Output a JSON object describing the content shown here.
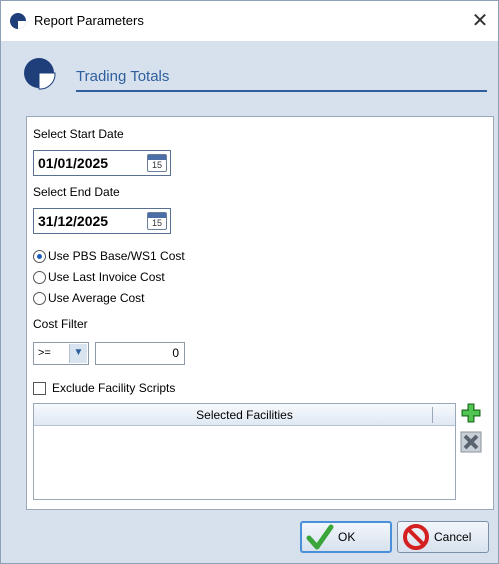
{
  "window": {
    "title": "Report Parameters",
    "close_glyph": "✕"
  },
  "header": {
    "title": "Trading Totals"
  },
  "dates": {
    "start_label": "Select Start Date",
    "start_value": "01/01/2025",
    "end_label": "Select End Date",
    "end_value": "31/12/2025",
    "calendar_day": "15"
  },
  "cost_options": [
    {
      "label": "Use PBS Base/WS1 Cost",
      "checked": true
    },
    {
      "label": "Use Last Invoice Cost",
      "checked": false
    },
    {
      "label": "Use Average Cost",
      "checked": false
    }
  ],
  "cost_filter": {
    "label": "Cost Filter",
    "operator": ">=",
    "value": "0"
  },
  "exclude_facility": {
    "label": "Exclude Facility Scripts",
    "checked": false
  },
  "facilities": {
    "header": "Selected Facilities",
    "rows": []
  },
  "buttons": {
    "ok": "OK",
    "cancel": "Cancel"
  },
  "colors": {
    "accent": "#2f5f9e",
    "add_green": "#3aa63a",
    "cancel_red": "#d42020"
  }
}
